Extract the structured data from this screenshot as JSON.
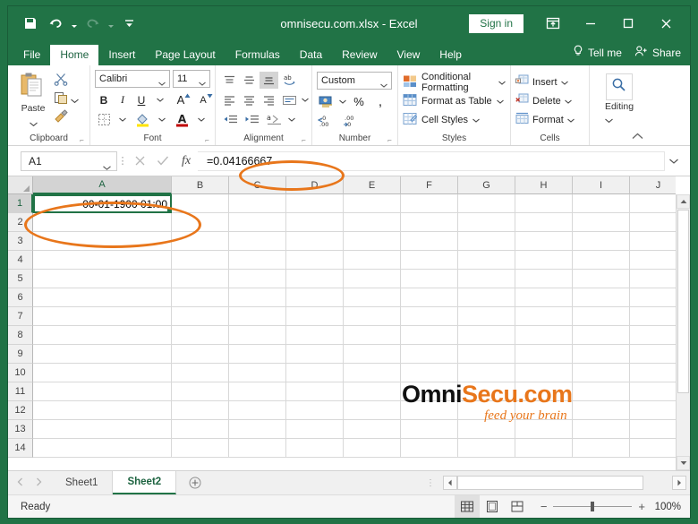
{
  "titlebar": {
    "document_title": "omnisecu.com.xlsx  -  Excel",
    "signin_label": "Sign in",
    "qat": [
      {
        "name": "save",
        "icon": "save-icon"
      },
      {
        "name": "undo",
        "icon": "undo-icon"
      },
      {
        "name": "redo",
        "icon": "redo-icon"
      },
      {
        "name": "customize",
        "icon": "customize-qat-icon"
      }
    ],
    "window_buttons": [
      {
        "name": "ribbon-display-options",
        "glyph": "ribbon-options-icon"
      },
      {
        "name": "minimize",
        "glyph": "minimize-icon"
      },
      {
        "name": "maximize",
        "glyph": "maximize-icon"
      },
      {
        "name": "close",
        "glyph": "close-icon"
      }
    ]
  },
  "ribbon": {
    "tabs": [
      {
        "label": "File",
        "active": false
      },
      {
        "label": "Home",
        "active": true
      },
      {
        "label": "Insert",
        "active": false
      },
      {
        "label": "Page Layout",
        "active": false
      },
      {
        "label": "Formulas",
        "active": false
      },
      {
        "label": "Data",
        "active": false
      },
      {
        "label": "Review",
        "active": false
      },
      {
        "label": "View",
        "active": false
      },
      {
        "label": "Help",
        "active": false
      }
    ],
    "tell_me": "Tell me",
    "share": "Share",
    "groups": {
      "clipboard": {
        "label": "Clipboard",
        "paste_label": "Paste",
        "items": [
          "Cut",
          "Copy",
          "Format Painter"
        ]
      },
      "font": {
        "label": "Font",
        "font_name": "Calibri",
        "font_size": "11",
        "bold": "B",
        "italic": "I",
        "underline": "U",
        "grow_font": "A",
        "shrink_font": "A"
      },
      "alignment": {
        "label": "Alignment"
      },
      "number": {
        "label": "Number",
        "format": "Custom",
        "percent": "%",
        "comma": ","
      },
      "styles": {
        "label": "Styles",
        "items": [
          "Conditional Formatting",
          "Format as Table",
          "Cell Styles"
        ]
      },
      "cells": {
        "label": "Cells",
        "items": [
          "Insert",
          "Delete",
          "Format"
        ]
      },
      "editing": {
        "label": "Editing"
      }
    }
  },
  "formula_bar": {
    "name_box": "A1",
    "cancel_icon": "cancel-icon",
    "enter_icon": "confirm-icon",
    "function_icon": "fx-icon",
    "value": "=0.04166667"
  },
  "sheet": {
    "columns": [
      "A",
      "B",
      "C",
      "D",
      "E",
      "F",
      "G",
      "H",
      "I",
      "J"
    ],
    "selected_column": "A",
    "rows": [
      "1",
      "2",
      "3",
      "4",
      "5",
      "6",
      "7",
      "8",
      "9",
      "10",
      "11",
      "12",
      "13",
      "14"
    ],
    "selected_row": "1",
    "active_cell": "A1",
    "cells": {
      "A1": "00-01-1900 01:00"
    }
  },
  "sheet_tabs": {
    "tabs": [
      {
        "label": "Sheet1",
        "active": false
      },
      {
        "label": "Sheet2",
        "active": true
      }
    ],
    "add_sheet_icon": "add-sheet-icon"
  },
  "status_bar": {
    "status": "Ready",
    "views": [
      {
        "name": "normal-view",
        "active": true
      },
      {
        "name": "page-layout-view",
        "active": false
      },
      {
        "name": "page-break-view",
        "active": false
      }
    ],
    "zoom_out": "−",
    "zoom_in": "+",
    "zoom_level": "100%"
  },
  "watermark": {
    "brand_first": "Omni",
    "brand_second": "Secu.com",
    "tagline": "feed your brain"
  },
  "annotations": {
    "color": "#E8761B",
    "targets": [
      "formula-bar-value",
      "cell-a1"
    ]
  }
}
